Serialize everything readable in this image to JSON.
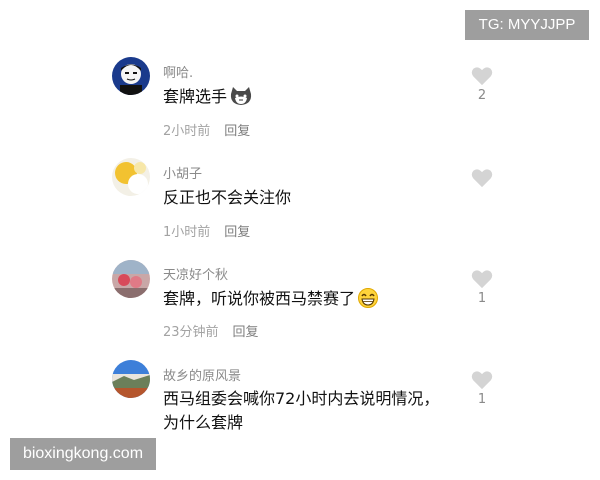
{
  "watermarks": {
    "telegram": "TG: MYYJJPP",
    "site": "bioxingkong.com"
  },
  "comments": [
    {
      "username": "啊哈.",
      "text": "套牌选手",
      "emoji": "cat-emoji",
      "time": "2小时前",
      "reply": "回复",
      "likes": "2"
    },
    {
      "username": "小胡子",
      "text": "反正也不会关注你",
      "emoji": "",
      "time": "1小时前",
      "reply": "回复",
      "likes": ""
    },
    {
      "username": "天凉好个秋",
      "text": "套牌，听说你被西马禁赛了",
      "emoji": "grin-emoji",
      "time": "23分钟前",
      "reply": "回复",
      "likes": "1"
    },
    {
      "username": "故乡的原风景",
      "text": "西马组委会喊你72小时内去说明情况，为什么套牌",
      "emoji": "",
      "time": "",
      "reply": "",
      "likes": "1"
    }
  ],
  "colors": {
    "heart": "#d4d4d4",
    "watermark_bg": "#9e9e9e"
  }
}
